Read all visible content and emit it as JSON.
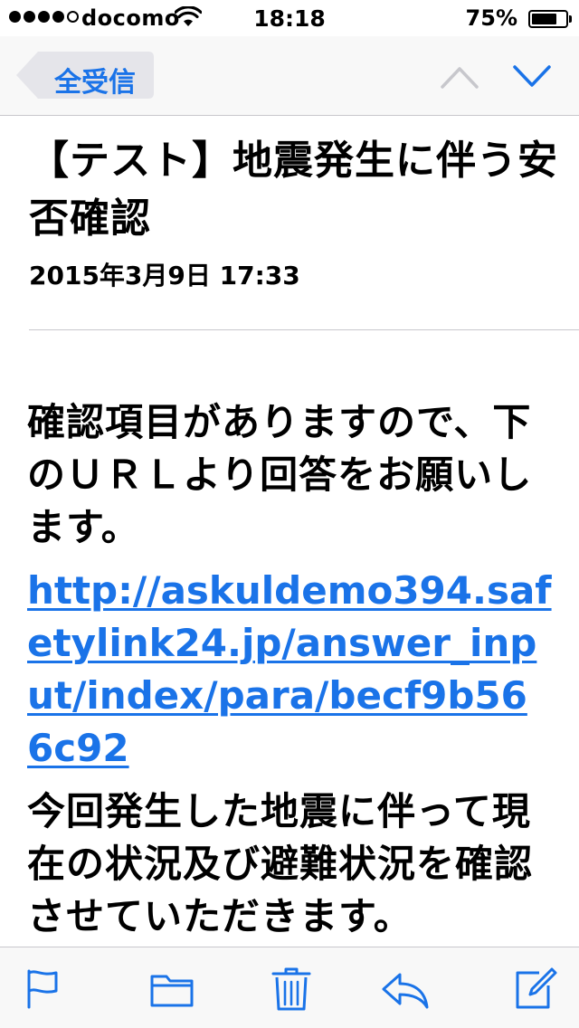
{
  "status_bar": {
    "carrier": "docomo",
    "time": "18:18",
    "battery_percent_text": "75%",
    "battery_level": 0.75,
    "signal_bars_filled": 4,
    "signal_bars_total": 5
  },
  "nav": {
    "back_label": "全受信",
    "up_icon": "chevron-up-icon",
    "down_icon": "chevron-down-icon"
  },
  "message": {
    "subject": "【テスト】地震発生に伴う安否確認",
    "date": "2015年3月9日 17:33",
    "body_intro": "確認項目がありますので、下のＵＲＬより回答をお願いします。",
    "link": "http://askuldemo394.safetylink24.jp/answer_input/index/para/becf9b566c92",
    "body_outro": "今回発生した地震に伴って現在の状況及び避難状況を確認させていただきます。"
  },
  "toolbar": {
    "items": [
      "flag-icon",
      "folder-icon",
      "trash-icon",
      "reply-icon",
      "compose-icon"
    ]
  },
  "colors": {
    "accent": "#1a73e8",
    "bar_background": "#f8f8f8",
    "separator": "#c8c7cc",
    "disabled": "#c7c7cc"
  }
}
